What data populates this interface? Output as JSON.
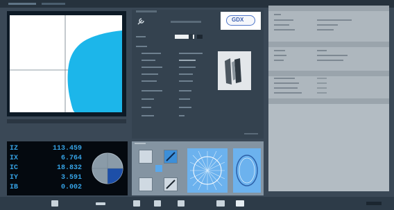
{
  "topbar": {
    "tabs": [
      "",
      ""
    ]
  },
  "header": {
    "title": ""
  },
  "mid": {
    "brand_logo": "GDX",
    "labels": [
      "",
      "",
      "",
      "",
      "",
      "",
      "",
      "",
      ""
    ],
    "values": [
      "",
      "",
      "",
      "",
      "",
      "",
      "",
      "",
      ""
    ]
  },
  "properties": {
    "sections": [
      "",
      "",
      "",
      ""
    ]
  },
  "readout": {
    "rows": [
      {
        "axis": "IZ",
        "value": "113.459"
      },
      {
        "axis": "IX",
        "value": "6.764"
      },
      {
        "axis": "IC",
        "value": "18.832"
      },
      {
        "axis": "IY",
        "value": "3.591"
      },
      {
        "axis": "IB",
        "value": "0.002"
      }
    ]
  },
  "colors": {
    "accent": "#36a3e6",
    "shape_fill": "#1cb6ea",
    "dark": "#04090f"
  },
  "icons": [
    "wrench-icon",
    "gauge-icon",
    "folder-icon",
    "save-icon",
    "tool-icon",
    "settings-icon",
    "grid-icon"
  ]
}
